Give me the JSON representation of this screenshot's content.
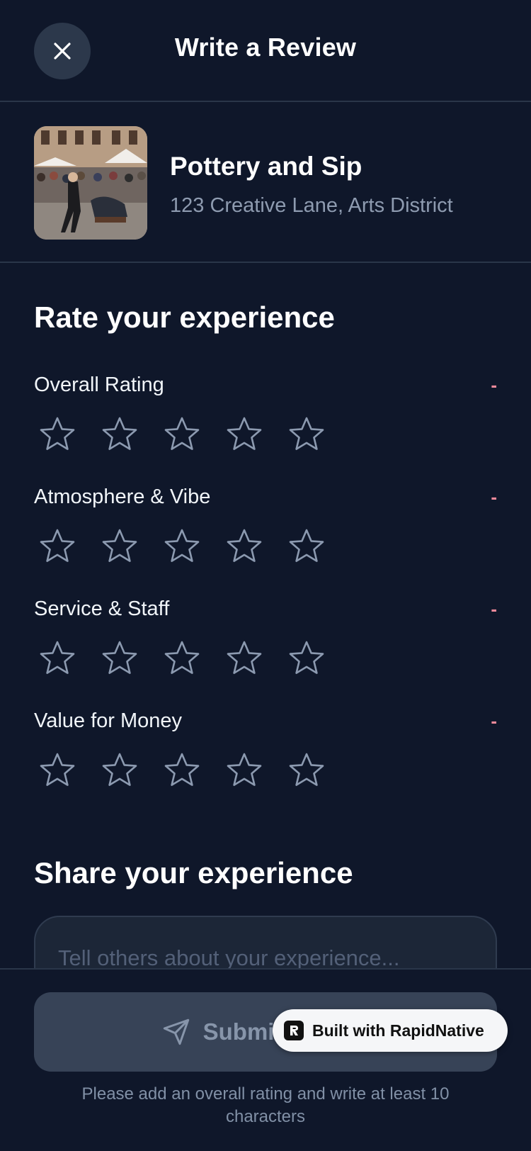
{
  "header": {
    "title": "Write a Review",
    "close_icon": "close-icon"
  },
  "venue": {
    "name": "Pottery and Sip",
    "address": "123 Creative Lane, Arts District",
    "photo_icon": "venue-photo"
  },
  "ratings_section": {
    "title": "Rate your experience",
    "categories": [
      {
        "label": "Overall Rating",
        "value": "-",
        "stars": 0
      },
      {
        "label": "Atmosphere & Vibe",
        "value": "-",
        "stars": 0
      },
      {
        "label": "Service & Staff",
        "value": "-",
        "stars": 0
      },
      {
        "label": "Value for Money",
        "value": "-",
        "stars": 0
      }
    ]
  },
  "review_section": {
    "title": "Share your experience",
    "placeholder": "Tell others about your experience...",
    "value": ""
  },
  "footer": {
    "submit_label": "Submit Review",
    "submit_icon": "send-icon",
    "hint": "Please add an overall rating and write at least 10 characters"
  },
  "badge": {
    "label": "Built with RapidNative",
    "logo_icon": "rapidnative-logo-icon"
  },
  "colors": {
    "background": "#0f172a",
    "divider": "#2a3649",
    "muted_text": "#8e9bb0",
    "accent_pink": "#f08a9b",
    "star_outline": "#8c9ab0",
    "button_disabled": "#374357"
  }
}
